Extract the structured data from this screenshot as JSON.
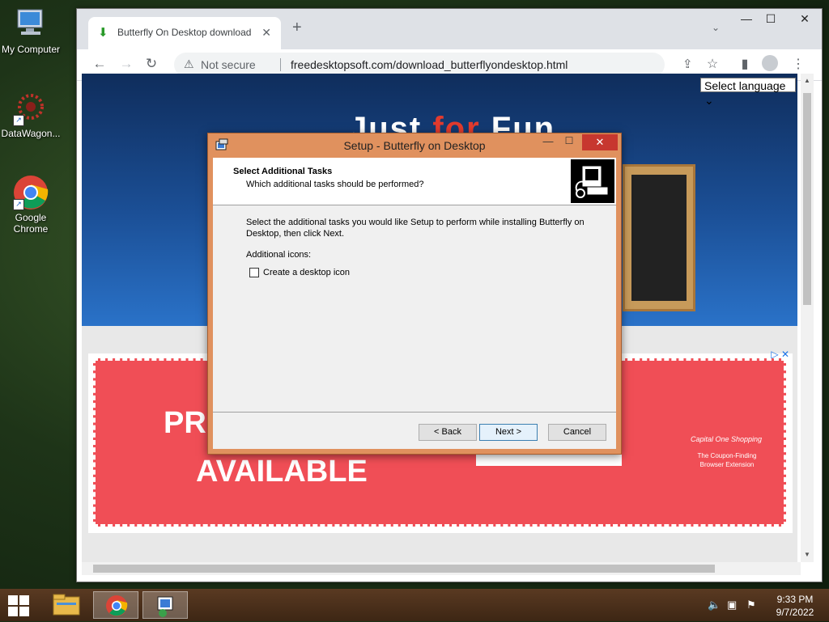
{
  "desktop": {
    "icons": [
      {
        "label": "My Computer"
      },
      {
        "label": "DataWagon..."
      },
      {
        "label": "Google Chrome"
      }
    ]
  },
  "browser": {
    "tab_title": "Butterfly On Desktop download",
    "security_label": "Not secure",
    "url": "freedesktopsoft.com/download_butterflyondesktop.html"
  },
  "page": {
    "language_select": "Select language",
    "hero_title_part1": "Just ",
    "hero_title_part2": "for",
    "hero_title_part3": " Fun",
    "ad": {
      "line1": "PRO",
      "line2": "AVAILABLE",
      "brand": "Capital One Shopping",
      "tagline": "The Coupon-Finding Browser Extension"
    }
  },
  "setup_dialog": {
    "title": "Setup - Butterfly on Desktop",
    "heading": "Select Additional Tasks",
    "subheading": "Which additional tasks should be performed?",
    "description": "Select the additional tasks you would like Setup to perform while installing Butterfly on Desktop, then click Next.",
    "section_label": "Additional icons:",
    "checkbox_label": "Create a desktop icon",
    "checkbox_checked": false,
    "buttons": {
      "back": "< Back",
      "next": "Next >",
      "cancel": "Cancel"
    }
  },
  "taskbar": {
    "time": "9:33 PM",
    "date": "9/7/2022"
  },
  "colors": {
    "dialog_frame": "#e0915e",
    "dialog_close": "#c7372f",
    "ad_background": "#f04e56",
    "taskbar": "#4a2f1a"
  }
}
